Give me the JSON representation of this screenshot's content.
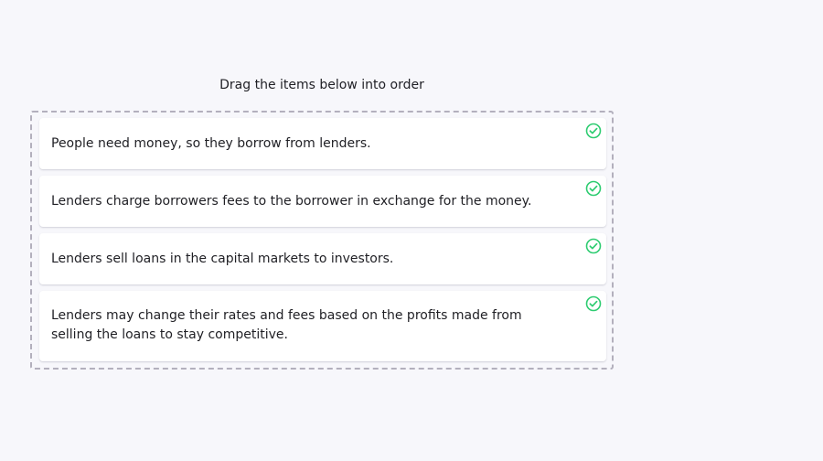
{
  "instruction": "Drag the items below into order",
  "items": [
    {
      "text": "People need money, so they borrow from lenders.",
      "status_icon": "check-circle-icon",
      "status_color": "#2ecc71"
    },
    {
      "text": "Lenders charge borrowers fees to the borrower in exchange for the money.",
      "status_icon": "check-circle-icon",
      "status_color": "#2ecc71"
    },
    {
      "text": "Lenders sell loans in the capital markets to investors.",
      "status_icon": "check-circle-icon",
      "status_color": "#2ecc71"
    },
    {
      "text": "Lenders may change their rates and fees based on the profits made from selling the loans to stay competitive.",
      "status_icon": "check-circle-icon",
      "status_color": "#2ecc71"
    }
  ],
  "colors": {
    "background": "#f7f7fb",
    "card": "#ffffff",
    "dash_border": "#b3b0bd",
    "correct": "#2ecc71"
  }
}
